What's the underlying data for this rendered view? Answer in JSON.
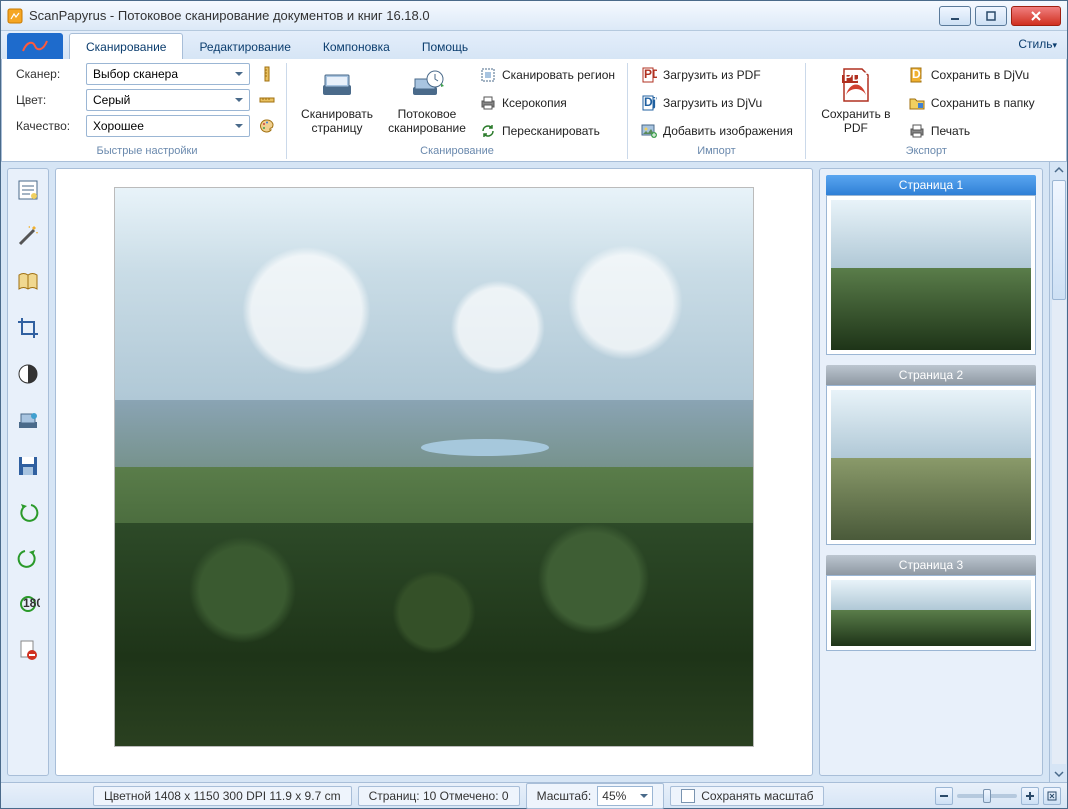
{
  "window": {
    "title": "ScanPapyrus - Потоковое сканирование документов и книг 16.18.0"
  },
  "tabs": {
    "items": [
      "Сканирование",
      "Редактирование",
      "Компоновка",
      "Помощь"
    ],
    "active_index": 0,
    "style_menu": "Стиль"
  },
  "quick": {
    "scanner_label": "Сканер:",
    "scanner_value": "Выбор сканера",
    "color_label": "Цвет:",
    "color_value": "Серый",
    "quality_label": "Качество:",
    "quality_value": "Хорошее",
    "group_label": "Быстрые настройки"
  },
  "scan_group": {
    "scan_page": "Сканировать страницу",
    "stream_scan": "Потоковое сканирование",
    "scan_region": "Сканировать регион",
    "xerox": "Ксерокопия",
    "rescan": "Пересканировать",
    "group_label": "Сканирование"
  },
  "import_group": {
    "load_pdf": "Загрузить из PDF",
    "load_djvu": "Загрузить из DjVu",
    "add_images": "Добавить изображения",
    "group_label": "Импорт"
  },
  "export_group": {
    "save_pdf": "Сохранить в PDF",
    "save_djvu": "Сохранить в DjVu",
    "save_folder": "Сохранить в папку",
    "print": "Печать",
    "group_label": "Экспорт"
  },
  "thumbs": {
    "page1": "Страница 1",
    "page2": "Страница 2",
    "page3": "Страница 3"
  },
  "status": {
    "info": "Цветной  1408 x 1150  300 DPI  11.9 x 9.7 cm",
    "pages": "Страниц: 10 Отмечено: 0",
    "zoom_label": "Масштаб:",
    "zoom_value": "45%",
    "keep_zoom": "Сохранять масштаб"
  }
}
